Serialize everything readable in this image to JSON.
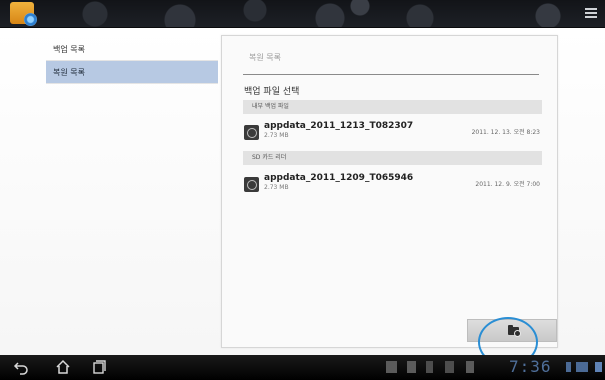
{
  "left_menu": {
    "items": [
      {
        "label": "백업 목록",
        "selected": false
      },
      {
        "label": "복원 목록",
        "selected": true
      }
    ]
  },
  "panel": {
    "header": "복원 목록",
    "select_title": "백업 파일 선택",
    "sections": [
      {
        "label": "내부 백업 파일",
        "files": [
          {
            "name": "appdata_2011_1213_T082307",
            "size": "2.73 MB",
            "date": "2011. 12. 13. 오전 8:23"
          }
        ]
      },
      {
        "label": "SD 카드 리더",
        "files": [
          {
            "name": "appdata_2011_1209_T065946",
            "size": "2.73 MB",
            "date": "2011. 12. 9. 오전 7:00"
          }
        ]
      }
    ],
    "restore_button_icon": "folder-restore-icon"
  },
  "system_bar": {
    "clock": "7:36",
    "nav_icons": [
      "back-icon",
      "home-icon",
      "recent-apps-icon"
    ]
  },
  "colors": {
    "selected_item_bg": "#b7c9e3",
    "highlight_circle": "#2a8ed4",
    "clock": "#4f6f9a"
  }
}
